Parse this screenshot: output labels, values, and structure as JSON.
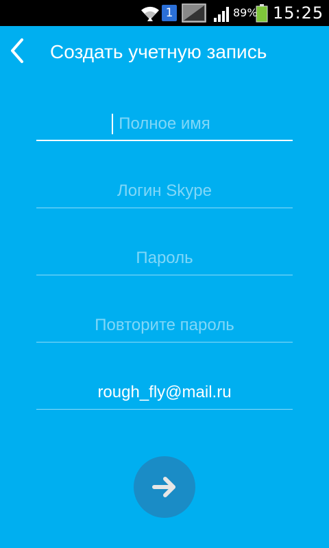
{
  "status_bar": {
    "notification_count": "1",
    "battery_percent": "89%",
    "time": "15:25",
    "icons": [
      "wifi-icon",
      "notification-icon",
      "image-icon",
      "signal-icon",
      "battery-icon"
    ]
  },
  "header": {
    "title": "Создать учетную запись",
    "back_icon": "chevron-left-icon"
  },
  "form": {
    "full_name": {
      "value": "",
      "placeholder": "Полное имя"
    },
    "login": {
      "value": "",
      "placeholder": "Логин Skype"
    },
    "password": {
      "value": "",
      "placeholder": "Пароль"
    },
    "repeat_password": {
      "value": "",
      "placeholder": "Повторите пароль"
    },
    "email": {
      "value": "rough_fly@mail.ru",
      "placeholder": ""
    }
  },
  "next_button": {
    "icon": "arrow-right-icon"
  },
  "colors": {
    "background": "#00aff0",
    "status_bar": "#000000",
    "next_button": "#1a8cc6",
    "battery_fill": "#7ec73a",
    "notification_badge": "#2b6fd6"
  }
}
